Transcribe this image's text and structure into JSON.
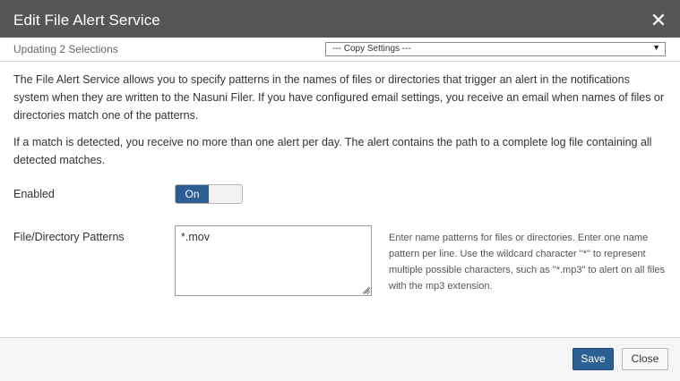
{
  "dialog": {
    "title": "Edit File Alert Service",
    "close_icon": "close-icon"
  },
  "subheader": {
    "selection_count": "Updating 2 Selections",
    "copy_settings": {
      "selected": "--- Copy Settings ---",
      "arrow_icon": "chevron-down-icon"
    }
  },
  "description": {
    "p1": "The File Alert Service allows you to specify patterns in the names of files or directories that trigger an alert in the notifications system when they are written to the Nasuni Filer. If you have configured email settings, you receive an email when names of files or directories match one of the patterns.",
    "p2": "If a match is detected, you receive no more than one alert per day. The alert contains the path to a complete log file containing all detected matches."
  },
  "form": {
    "enabled_label": "Enabled",
    "toggle_on_label": "On",
    "patterns_label": "File/Directory Patterns",
    "patterns_value": "*.mov",
    "patterns_help": "Enter name patterns for files or directories. Enter one name pattern per line. Use the wildcard character \"*\" to represent multiple possible characters, such as \"*.mp3\" to alert on all files with the mp3 extension."
  },
  "footer": {
    "save_label": "Save",
    "close_label": "Close"
  },
  "colors": {
    "title_bar": "#565656",
    "accent": "#2b5f94",
    "footer_bg": "#f5f5f5"
  }
}
